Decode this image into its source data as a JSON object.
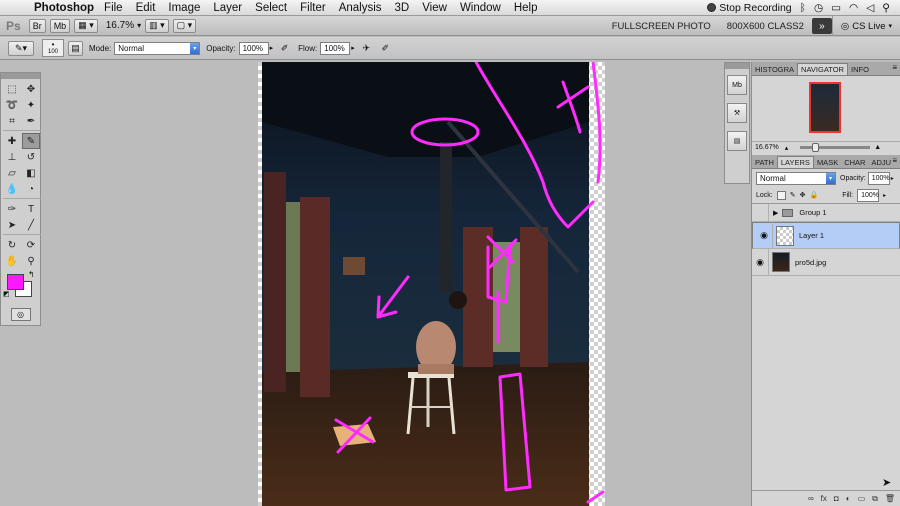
{
  "menubar": {
    "apple": "",
    "app_name": "Photoshop",
    "items": [
      "File",
      "Edit",
      "Image",
      "Layer",
      "Select",
      "Filter",
      "Analysis",
      "3D",
      "View",
      "Window",
      "Help"
    ],
    "recording": "Stop Recording"
  },
  "appbar": {
    "logo": "Ps",
    "mb": "Mb",
    "zoom": "16.7%",
    "workspaces": [
      "FULLSCREEN PHOTO",
      "800X600 CLASS2"
    ],
    "cs_live": "CS Live"
  },
  "options": {
    "brush_size": "100",
    "mode_label": "Mode:",
    "mode_value": "Normal",
    "opacity_label": "Opacity:",
    "opacity_value": "100%",
    "flow_label": "Flow:",
    "flow_value": "100%"
  },
  "tools": {
    "foreground_color": "#ff19ff",
    "background_color": "#ffffff"
  },
  "navigator": {
    "tabs": [
      "HISTOGRA",
      "NAVIGATOR",
      "INFO"
    ],
    "active_tab": "NAVIGATOR",
    "zoom": "16.67%"
  },
  "layers_panel": {
    "tabs": [
      "PATH",
      "LAYERS",
      "MASK",
      "CHAR",
      "ADJU"
    ],
    "active_tab": "LAYERS",
    "blend_mode": "Normal",
    "opacity_label": "Opacity:",
    "opacity_value": "100%",
    "lock_label": "Lock:",
    "fill_label": "Fill:",
    "fill_value": "100%",
    "layers": [
      {
        "name": "Group 1",
        "type": "group",
        "visible": false
      },
      {
        "name": "Layer 1",
        "type": "layer",
        "visible": true,
        "selected": true
      },
      {
        "name": "pro5d.jpg",
        "type": "image",
        "visible": true
      }
    ]
  }
}
